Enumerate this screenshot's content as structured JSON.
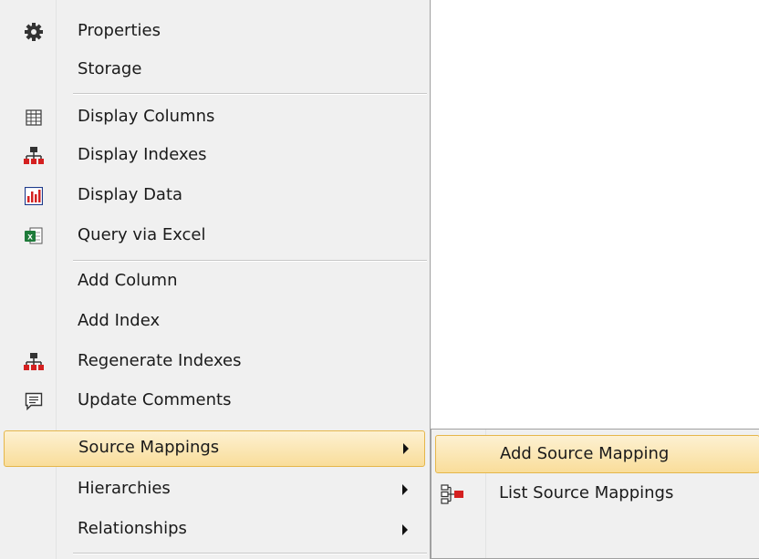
{
  "context_menu": {
    "items": [
      {
        "label": "Properties",
        "icon": "gear-icon"
      },
      {
        "label": "Storage",
        "icon": ""
      },
      {
        "label": "Display Columns",
        "icon": "grid-columns-icon"
      },
      {
        "label": "Display Indexes",
        "icon": "index-tree-icon"
      },
      {
        "label": "Display Data",
        "icon": "bar-chart-icon"
      },
      {
        "label": "Query via Excel",
        "icon": "excel-icon"
      },
      {
        "label": "Add Column",
        "icon": ""
      },
      {
        "label": "Add Index",
        "icon": ""
      },
      {
        "label": "Regenerate Indexes",
        "icon": "index-tree-icon"
      },
      {
        "label": "Update Comments",
        "icon": "comment-icon"
      },
      {
        "label": "Source Mappings",
        "icon": "",
        "submenu": true,
        "highlighted": true
      },
      {
        "label": "Hierarchies",
        "icon": "",
        "submenu": true
      },
      {
        "label": "Relationships",
        "icon": "",
        "submenu": true
      }
    ]
  },
  "submenu": {
    "items": [
      {
        "label": "Add Source Mapping",
        "icon": "",
        "highlighted": true
      },
      {
        "label": "List Source Mappings",
        "icon": "source-mapping-icon"
      }
    ]
  },
  "colors": {
    "menu_bg": "#f0f0f0",
    "highlight": "#f9dd9a",
    "highlight_border": "#e5b64a",
    "icon_red": "#d42020"
  }
}
